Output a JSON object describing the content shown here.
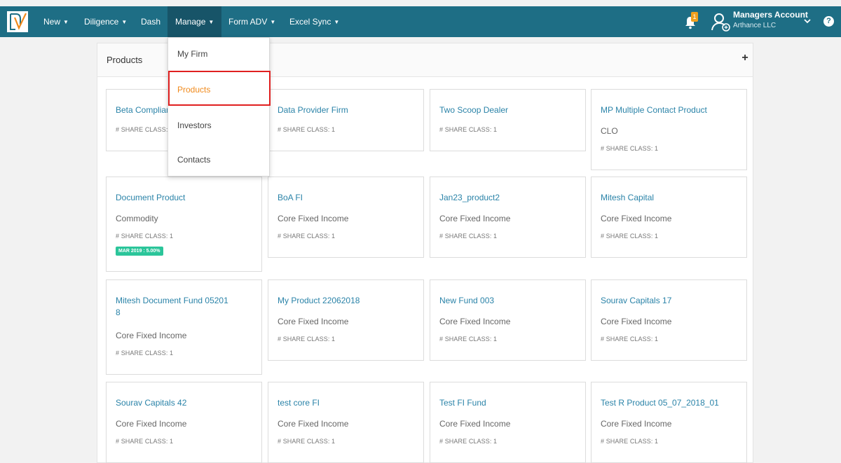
{
  "nav": {
    "items": [
      {
        "label": "New",
        "caret": true
      },
      {
        "label": "Diligence",
        "caret": true
      },
      {
        "label": "Dash",
        "caret": false
      },
      {
        "label": "Manage",
        "caret": true
      },
      {
        "label": "Form ADV",
        "caret": true
      },
      {
        "label": "Excel Sync",
        "caret": true
      }
    ],
    "notification_count": "1",
    "account_name": "Managers Account",
    "account_org": "Arthance LLC",
    "help_label": "?"
  },
  "icons": {
    "logo": "logo-icon",
    "bell": "bell-icon",
    "avatar": "user-icon",
    "chevron": "chevron-down-icon",
    "help": "help-icon",
    "add": "plus-icon"
  },
  "panel": {
    "title": "Products",
    "add_label": "+"
  },
  "dropdown": {
    "items": [
      "My Firm",
      "Products",
      "Investors",
      "Contacts"
    ],
    "selected": "Products"
  },
  "cards": [
    {
      "title": "Beta Complian",
      "sub": "",
      "share": "# SHARE CLASS: 1",
      "tag": ""
    },
    {
      "title": "Data Provider Firm",
      "sub": "",
      "share": "# SHARE CLASS: 1",
      "tag": ""
    },
    {
      "title": "Two Scoop Dealer",
      "sub": "",
      "share": "# SHARE CLASS: 1",
      "tag": ""
    },
    {
      "title": "MP Multiple Contact Product",
      "sub": "CLO",
      "share": "# SHARE CLASS: 1",
      "tag": ""
    },
    {
      "title": "Document Product",
      "sub": "Commodity",
      "share": "# SHARE CLASS: 1",
      "tag": "MAR 2019 : 5.00%"
    },
    {
      "title": "BoA FI",
      "sub": "Core Fixed Income",
      "share": "# SHARE CLASS: 1",
      "tag": ""
    },
    {
      "title": "Jan23_product2",
      "sub": "Core Fixed Income",
      "share": "# SHARE CLASS: 1",
      "tag": ""
    },
    {
      "title": "Mitesh Capital",
      "sub": "Core Fixed Income",
      "share": "# SHARE CLASS: 1",
      "tag": ""
    },
    {
      "title": "Mitesh Document Fund 052018",
      "title_line1": "Mitesh Document Fund 05201",
      "title_line2": "8",
      "sub": "Core Fixed Income",
      "share": "# SHARE CLASS: 1",
      "tag": ""
    },
    {
      "title": "My Product 22062018",
      "sub": "Core Fixed Income",
      "share": "# SHARE CLASS: 1",
      "tag": ""
    },
    {
      "title": "New Fund 003",
      "sub": "Core Fixed Income",
      "share": "# SHARE CLASS: 1",
      "tag": ""
    },
    {
      "title": "Sourav Capitals 17",
      "sub": "Core Fixed Income",
      "share": "# SHARE CLASS: 1",
      "tag": ""
    },
    {
      "title": "Sourav Capitals 42",
      "sub": "Core Fixed Income",
      "share": "# SHARE CLASS: 1",
      "tag": ""
    },
    {
      "title": "test core FI",
      "sub": "Core Fixed Income",
      "share": "# SHARE CLASS: 1",
      "tag": ""
    },
    {
      "title": "Test FI Fund",
      "sub": "Core Fixed Income",
      "share": "# SHARE CLASS: 1",
      "tag": ""
    },
    {
      "title": "Test R Product 05_07_2018_01",
      "sub": "Core Fixed Income",
      "share": "# SHARE CLASS: 1",
      "tag": ""
    }
  ]
}
